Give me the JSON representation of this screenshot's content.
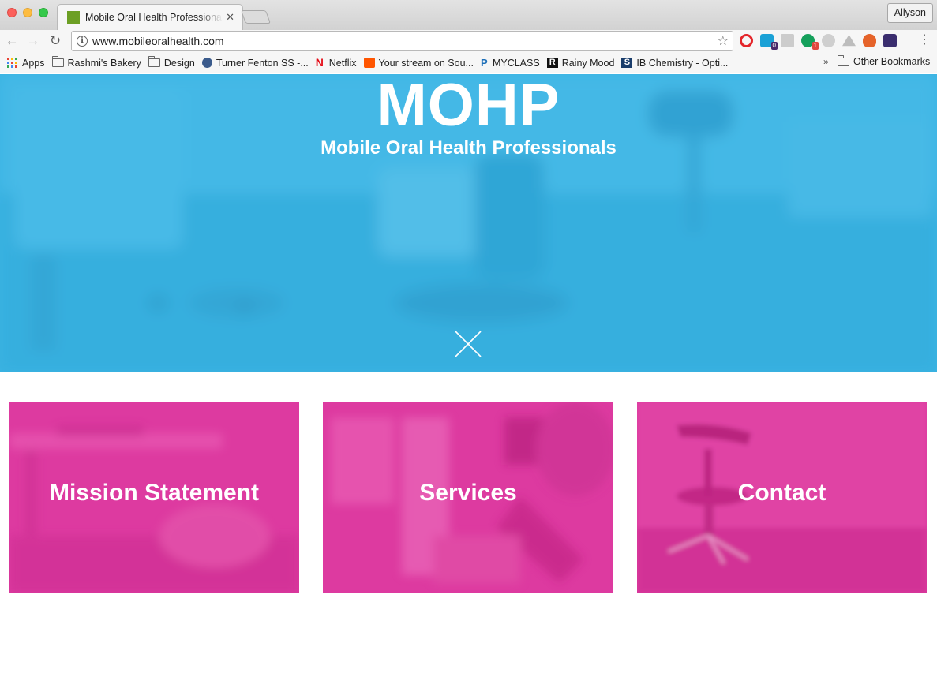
{
  "browser": {
    "tab_title": "Mobile Oral Health Professionals",
    "profile_name": "Allyson",
    "url": "www.mobileoralhealth.com",
    "extensions": [
      {
        "name": "opera-icon",
        "color": "#e4252a",
        "badge": ""
      },
      {
        "name": "puzzle-icon",
        "color": "#1aa1d6",
        "badge": "0"
      },
      {
        "name": "image-icon",
        "color": "#cccccc",
        "badge": ""
      },
      {
        "name": "grammarly-icon",
        "color": "#15a05b",
        "badge": "1"
      },
      {
        "name": "m-icon",
        "color": "#cfcfcf",
        "badge": ""
      },
      {
        "name": "drive-icon",
        "color": "#bdbdbd",
        "badge": ""
      },
      {
        "name": "fire-icon",
        "color": "#e5632a",
        "badge": ""
      },
      {
        "name": "astronomy-icon",
        "color": "#3a2d6e",
        "badge": ""
      }
    ],
    "bookmarks": [
      {
        "label": "Apps",
        "icon": "apps-grid-icon"
      },
      {
        "label": "Rashmi's Bakery",
        "icon": "folder-icon"
      },
      {
        "label": "Design",
        "icon": "folder-icon"
      },
      {
        "label": "Turner Fenton SS -...",
        "icon": "globe-icon"
      },
      {
        "label": "Netflix",
        "icon": "netflix-icon"
      },
      {
        "label": "Your stream on Sou...",
        "icon": "soundcloud-icon"
      },
      {
        "label": "MYCLASS",
        "icon": "p-icon"
      },
      {
        "label": "Rainy Mood",
        "icon": "r-icon"
      },
      {
        "label": "IB Chemistry - Opti...",
        "icon": "s-icon"
      }
    ],
    "bookmarks_more": "»",
    "other_bookmarks": "Other Bookmarks"
  },
  "hero": {
    "title": "MOHP",
    "subtitle": "Mobile Oral Health Professionals",
    "overlay_color": "#3db5e4",
    "close_icon": "close-x-icon"
  },
  "cards": [
    {
      "label": "Mission Statement",
      "color": "#dd3aa0"
    },
    {
      "label": "Services",
      "color": "#dd3aa0"
    },
    {
      "label": "Contact",
      "color": "#dd3aa0"
    }
  ]
}
